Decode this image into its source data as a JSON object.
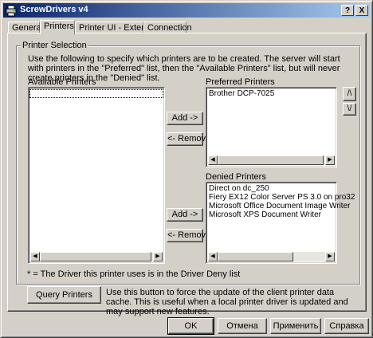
{
  "window": {
    "title": "ScrewDrivers v4",
    "help_glyph": "?",
    "close_glyph": "X"
  },
  "tabs": [
    {
      "label": "General",
      "active": false
    },
    {
      "label": "Printers",
      "active": true
    },
    {
      "label": "Printer UI - Extended",
      "active": false
    },
    {
      "label": "Connection",
      "active": false
    }
  ],
  "printer_selection": {
    "group_label": "Printer Selection",
    "description": "Use the following to specify which printers are to be created.  The server will start with printers in the \"Preferred\" list, then the \"Available Printers\" list, but will never create printers in the \"Denied\" list.",
    "available_label": "Available Printers",
    "available_items": [],
    "preferred_label": "Preferred Printers",
    "preferred_items": [
      "Brother DCP-7025"
    ],
    "denied_label": "Denied Printers",
    "denied_items": [
      "Direct on dc_250",
      "Fiery EX12 Color Server PS 3.0 on pro32",
      "Microsoft Office Document Image Writer",
      "Microsoft XPS Document Writer"
    ],
    "add_label": "Add ->",
    "remove_label": "<- Remove",
    "move_up_label": "/\\",
    "move_down_label": "\\/",
    "note": "* = The Driver this printer uses is in the Driver Deny list"
  },
  "query": {
    "button_label": "Query Printers",
    "description": "Use this button to force the update of the client printer data cache.  This is useful when a local printer driver is updated and may support new features."
  },
  "footer": {
    "ok_label": "OK",
    "cancel_label": "Отмена",
    "apply_label": "Применить",
    "help_label": "Справка"
  },
  "icons": {
    "app": "printer-app-icon",
    "scroll_left": "arrow-left-icon",
    "scroll_right": "arrow-right-icon"
  },
  "colors": {
    "titlebar_start": "#0a246a",
    "titlebar_end": "#a6caf0",
    "face": "#d4d0c8"
  }
}
